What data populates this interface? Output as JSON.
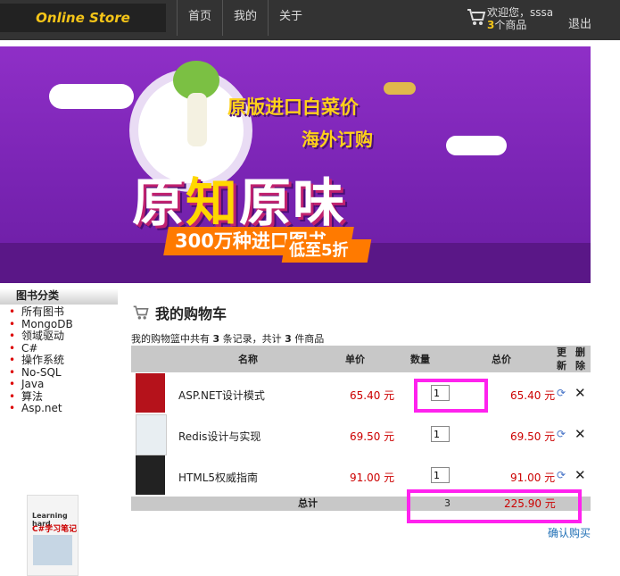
{
  "header": {
    "logo": "Online Store",
    "nav": [
      "首页",
      "我的",
      "关于"
    ],
    "welcome": "欢迎您，sssa",
    "cart_count": "3",
    "cart_count_suffix": "个商品",
    "logout": "退出"
  },
  "banner": {
    "line1": "原版进口白菜价",
    "line2": "海外订购",
    "big_left": "原",
    "big_mid": "知",
    "big_right": "原味",
    "ribbon1": "300万种进口图书",
    "ribbon2": "低至5折"
  },
  "sidebar": {
    "title": "图书分类",
    "items": [
      "所有图书",
      "MongoDB",
      "领域驱动",
      "C#",
      "操作系统",
      "No-SQL",
      "Java",
      "算法",
      "Asp.net"
    ],
    "book_title": "Learning hard",
    "book_subtitle": "C#学习笔记"
  },
  "cart": {
    "title": "我的购物车",
    "summary_prefix": "我的购物篮中共有",
    "record_count": "3",
    "summary_mid": "条记录，共计",
    "item_count": "3",
    "summary_suffix": "件商品",
    "columns": {
      "name": "名称",
      "price": "单价",
      "qty": "数量",
      "total": "总价",
      "refresh_1": "更",
      "refresh_2": "新",
      "del_1": "删",
      "del_2": "除"
    },
    "rows": [
      {
        "name": "ASP.NET设计模式",
        "price": "65.40 元",
        "qty": "1",
        "total": "65.40 元"
      },
      {
        "name": "Redis设计与实现",
        "price": "69.50 元",
        "qty": "1",
        "total": "69.50 元"
      },
      {
        "name": "HTML5权威指南",
        "price": "91.00 元",
        "qty": "1",
        "total": "91.00 元"
      }
    ],
    "footer": {
      "label": "总计",
      "qty": "3",
      "sum": "225.90 元"
    },
    "confirm": "确认购买"
  },
  "colors": {
    "topbar": "#333333",
    "accent": "#f5c518",
    "price": "#cc0000",
    "highlight": "#ff22ee",
    "link": "#1f6fb5"
  }
}
